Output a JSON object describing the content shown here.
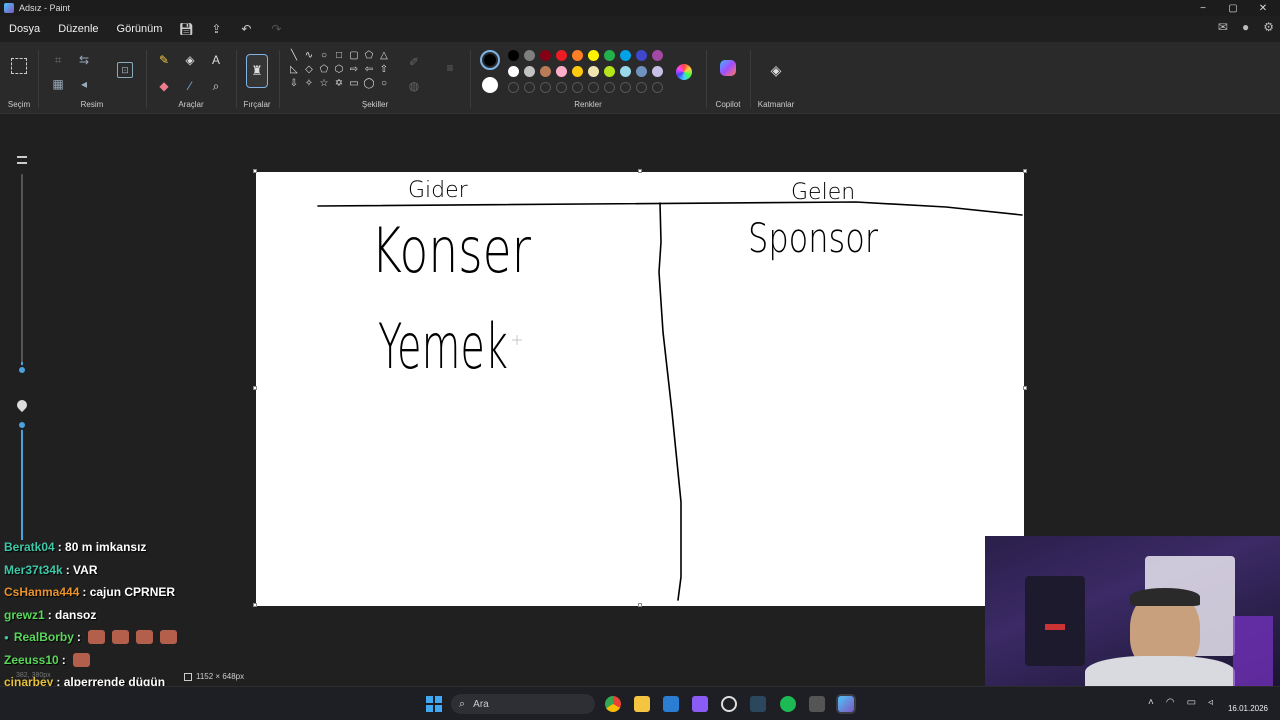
{
  "window": {
    "title": "Adsız - Paint",
    "minimize": "−",
    "maximize": "▢",
    "close": "✕"
  },
  "menu": {
    "items": [
      "Dosya",
      "Düzenle",
      "Görünüm"
    ]
  },
  "ribbon": {
    "groups": {
      "selection": "Seçim",
      "image": "Resim",
      "tools": "Araçlar",
      "brushes": "Fırçalar",
      "shapes": "Şekiller",
      "colors": "Renkler",
      "copilot": "Copilot",
      "layers": "Katmanlar"
    },
    "palette_row1": [
      "#000000",
      "#7f7f7f",
      "#880015",
      "#ed1c24",
      "#ff7f27",
      "#fff200",
      "#22b14c",
      "#00a2e8",
      "#3f48cc",
      "#a349a4"
    ],
    "palette_row2": [
      "#ffffff",
      "#c3c3c3",
      "#b97a57",
      "#ffaec9",
      "#ffc90e",
      "#efe4b0",
      "#b5e61d",
      "#99d9ea",
      "#7092be",
      "#c8bfe7"
    ],
    "primary_color": "#000000",
    "secondary_color": "#ffffff"
  },
  "canvas": {
    "columns": [
      "Gider",
      "Gelen"
    ],
    "left_items": [
      "Konser",
      "Yemek"
    ],
    "right_items": [
      "Sponsor"
    ],
    "size": "1152 × 648px",
    "cursor_position": "382, 380px"
  },
  "chat": [
    {
      "user": "Beratk04",
      "color": "#3ec8a8",
      "message": ": 80 m imkansız"
    },
    {
      "user": "Mer37t34k",
      "color": "#3ec8a8",
      "message": ": VAR"
    },
    {
      "user": "CsHanma444",
      "color": "#e8912d",
      "message": ": cajun CPRNER"
    },
    {
      "user": "grewz1",
      "color": "#59d65a",
      "message": ": dansoz"
    },
    {
      "user": "RealBorby",
      "color": "#59d65a",
      "message": ":",
      "emotes": 4,
      "badge": true
    },
    {
      "user": "Zeeuss10",
      "color": "#59d65a",
      "message": ":",
      "emotes": 1
    },
    {
      "user": "cinarbey",
      "color": "#e8c23a",
      "message": ": alperrende dügün"
    }
  ],
  "taskbar": {
    "search_placeholder": "Ara",
    "date": "16.01.2026"
  }
}
